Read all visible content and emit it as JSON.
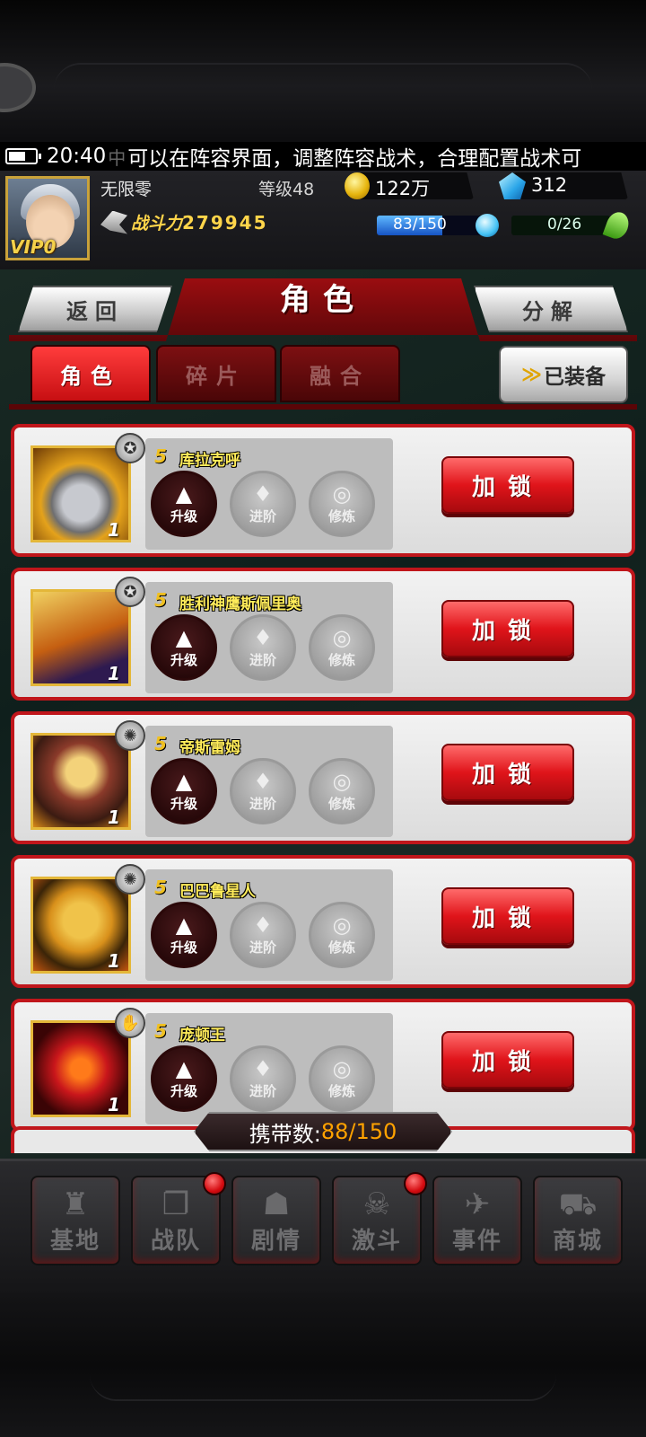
{
  "status_bar": {
    "time": "20:40",
    "ticker_sep": "中",
    "ticker": "可以在阵容界面，调整阵容战术，合理配置战术可"
  },
  "player": {
    "name": "无限零",
    "vip_label": "VIP0",
    "level": "等级48",
    "gold": "122万",
    "gems": "312",
    "power_label": "战斗力",
    "power_value": "279945",
    "stamina": "83/150",
    "stamina_fraction": 0.553,
    "exp": "0/26",
    "exp_fraction": 0
  },
  "header": {
    "title": "角色",
    "back_label": "返回",
    "decompose_label": "分解",
    "tabs": [
      {
        "label": "角色",
        "active": true
      },
      {
        "label": "碎片",
        "active": false
      },
      {
        "label": "融合",
        "active": false
      }
    ],
    "equipped_label": "已装备",
    "equipped_chevron": "≫"
  },
  "actions": {
    "upgrade": "升级",
    "advance": "进阶",
    "train": "修炼",
    "lock": "加锁"
  },
  "cards": [
    {
      "rank": "5",
      "name": "库拉克呼",
      "count": "1",
      "badge_icon": "spiral-badge-icon"
    },
    {
      "rank": "5",
      "name": "胜利神鹰斯佩里奥",
      "count": "1",
      "badge_icon": "spiral-badge-icon"
    },
    {
      "rank": "5",
      "name": "帝斯雷姆",
      "count": "1",
      "badge_icon": "claw-badge-icon"
    },
    {
      "rank": "5",
      "name": "巴巴鲁星人",
      "count": "1",
      "badge_icon": "claw-badge-icon"
    },
    {
      "rank": "5",
      "name": "庞顿王",
      "count": "1",
      "badge_icon": "paw-badge-icon"
    }
  ],
  "carry": {
    "label": "携带数:",
    "value": "88/150"
  },
  "nav": [
    {
      "label": "基地",
      "icon": "base-icon",
      "dot": false
    },
    {
      "label": "战队",
      "icon": "team-icon",
      "dot": true
    },
    {
      "label": "剧情",
      "icon": "story-icon",
      "dot": false
    },
    {
      "label": "激斗",
      "icon": "battle-icon",
      "dot": true
    },
    {
      "label": "事件",
      "icon": "event-icon",
      "dot": false
    },
    {
      "label": "商城",
      "icon": "shop-icon",
      "dot": false
    }
  ],
  "colors": {
    "accent_red": "#c0161b",
    "gold_text": "#ffd54a",
    "carry_value": "#ffa200"
  }
}
